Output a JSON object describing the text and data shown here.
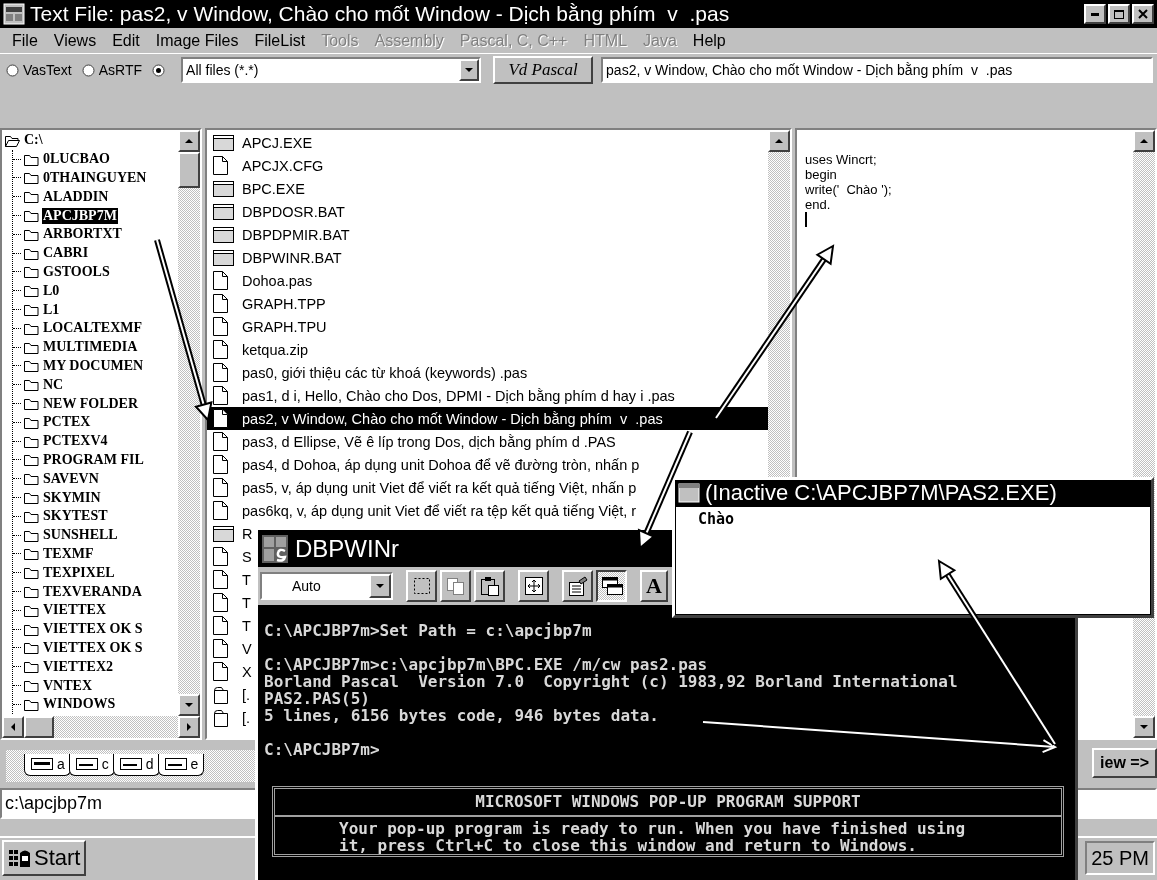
{
  "window": {
    "title": "Text File: pas2, v Window, Chào cho mốt Window - Dịch bằng phím  v  .pas"
  },
  "menu": [
    {
      "label": "File",
      "disabled": false
    },
    {
      "label": "Views",
      "disabled": false
    },
    {
      "label": "Edit",
      "disabled": false
    },
    {
      "label": "Image Files",
      "disabled": false
    },
    {
      "label": "FileList",
      "disabled": false
    },
    {
      "label": "Tools",
      "disabled": true
    },
    {
      "label": "Assembly",
      "disabled": true
    },
    {
      "label": "Pascal, C, C++",
      "disabled": true
    },
    {
      "label": "HTML",
      "disabled": true
    },
    {
      "label": "Java",
      "disabled": true
    },
    {
      "label": "Help",
      "disabled": false
    }
  ],
  "toolbar": {
    "radios": [
      {
        "label": "VasText",
        "selected": false
      },
      {
        "label": "AsRTF",
        "selected": false
      },
      {
        "selected": true
      }
    ],
    "filter": "All files (*.*)",
    "pascal_button": "Vd Pascal",
    "path": "pas2, v Window, Chào cho mốt Window - Dịch bằng phím  v  .pas"
  },
  "tree": {
    "label": "C:\\",
    "expanded": true,
    "children": [
      {
        "label": "0LUCBAO",
        "selected": false
      },
      {
        "label": "0THAINGUYEN",
        "selected": false
      },
      {
        "label": "ALADDIN",
        "selected": false
      },
      {
        "label": "APCJBP7M",
        "selected": true
      },
      {
        "label": "ARBORTXT",
        "selected": false
      },
      {
        "label": "CABRI",
        "selected": false
      },
      {
        "label": "GSTOOLS",
        "selected": false
      },
      {
        "label": "L0",
        "selected": false
      },
      {
        "label": "L1",
        "selected": false
      },
      {
        "label": "LOCALTEXMF",
        "selected": false
      },
      {
        "label": "MULTIMEDIA",
        "selected": false
      },
      {
        "label": "MY DOCUMEN",
        "selected": false
      },
      {
        "label": "NC",
        "selected": false
      },
      {
        "label": "NEW FOLDER",
        "selected": false
      },
      {
        "label": "PCTEX",
        "selected": false
      },
      {
        "label": "PCTEXV4",
        "selected": false
      },
      {
        "label": "PROGRAM FIL",
        "selected": false
      },
      {
        "label": "SAVEVN",
        "selected": false
      },
      {
        "label": "SKYMIN",
        "selected": false
      },
      {
        "label": "SKYTEST",
        "selected": false
      },
      {
        "label": "SUNSHELL",
        "selected": false
      },
      {
        "label": "TEXMF",
        "selected": false
      },
      {
        "label": "TEXPIXEL",
        "selected": false
      },
      {
        "label": "TEXVERANDA",
        "selected": false
      },
      {
        "label": "VIETTEX",
        "selected": false
      },
      {
        "label": "VIETTEX OK S",
        "selected": false
      },
      {
        "label": "VIETTEX OK S",
        "selected": false
      },
      {
        "label": "VIETTEX2",
        "selected": false
      },
      {
        "label": "VNTEX",
        "selected": false
      },
      {
        "label": "WINDOWS",
        "selected": false
      }
    ]
  },
  "file_list": {
    "rows": [
      {
        "name": "APCJ.EXE",
        "kind": "program",
        "selected": false
      },
      {
        "name": "APCJX.CFG",
        "kind": "document",
        "selected": false
      },
      {
        "name": "BPC.EXE",
        "kind": "program",
        "selected": false
      },
      {
        "name": "DBPDOSR.BAT",
        "kind": "program",
        "selected": false
      },
      {
        "name": "DBPDPMIR.BAT",
        "kind": "program",
        "selected": false
      },
      {
        "name": "DBPWINR.BAT",
        "kind": "program",
        "selected": false
      },
      {
        "name": "Dohoa.pas",
        "kind": "document",
        "selected": false
      },
      {
        "name": "GRAPH.TPP",
        "kind": "document",
        "selected": false
      },
      {
        "name": "GRAPH.TPU",
        "kind": "document",
        "selected": false
      },
      {
        "name": "ketqua.zip",
        "kind": "document",
        "selected": false
      },
      {
        "name": "pas0, giới thiệu các từ khoá (keywords) .pas",
        "kind": "document",
        "selected": false
      },
      {
        "name": "pas1, d i, Hello, Chào cho Dos, DPMI - Dịch bằng phím d hay i .pas",
        "kind": "document",
        "selected": false
      },
      {
        "name": "pas2, v Window, Chào cho mốt Window - Dịch bằng phím  v  .pas",
        "kind": "document",
        "selected": true
      },
      {
        "name": "pas3, d Ellipse, Vẽ ê líp trong Dos, dịch bằng phím d .PAS",
        "kind": "document",
        "selected": false
      },
      {
        "name": "pas4, d Dohoa, áp dụng unit Dohoa để vẽ đường tròn, nhấn p",
        "kind": "document",
        "selected": false
      },
      {
        "name": "pas5, v, áp dụng unit Viet để viết ra kết quả tiếng Việt, nhấn p",
        "kind": "document",
        "selected": false
      },
      {
        "name": "pas6kq, v, áp dụng unit Viet để viết ra tệp kết quả tiếng Việt, r",
        "kind": "document",
        "selected": false
      },
      {
        "name": "R",
        "kind": "program",
        "selected": false
      },
      {
        "name": "S",
        "kind": "document",
        "selected": false
      },
      {
        "name": "T",
        "kind": "document",
        "selected": false
      },
      {
        "name": "T",
        "kind": "document",
        "selected": false
      },
      {
        "name": "T",
        "kind": "document",
        "selected": false
      },
      {
        "name": "V",
        "kind": "document",
        "selected": false
      },
      {
        "name": "X",
        "kind": "document",
        "selected": false
      },
      {
        "name": "[.",
        "kind": "folder",
        "selected": false
      },
      {
        "name": "[.",
        "kind": "folder",
        "selected": false
      }
    ]
  },
  "editor": {
    "lines": [
      "uses Wincrt;",
      "begin",
      "write('  Chào ');",
      "end."
    ]
  },
  "drive_tabs": [
    {
      "label": "a",
      "kind": "floppy"
    },
    {
      "label": "c",
      "kind": "disk"
    },
    {
      "label": "d",
      "kind": "disk"
    },
    {
      "label": "e",
      "kind": "disk"
    }
  ],
  "view_button": "iew =>",
  "current_path": "c:\\apcjbp7m",
  "taskbar": {
    "start": "Start",
    "clock": "25 PM"
  },
  "dos_window": {
    "title": "DBPWINr",
    "font_size": "Auto",
    "font_button": "A",
    "console_blocks": [
      [
        "C:\\APCJBP7m>Set Path = c:\\apcjbp7m"
      ],
      [
        "C:\\APCJBP7m>c:\\apcjbp7m\\BPC.EXE /m/cw pas2.pas",
        "Borland Pascal  Version 7.0  Copyright (c) 1983,92 Borland International",
        "PAS2.PAS(5)",
        "5 lines, 6156 bytes code, 946 bytes data."
      ],
      [
        "C:\\APCJBP7m>"
      ]
    ],
    "popup": {
      "title": "MICROSOFT WINDOWS POP-UP PROGRAM SUPPORT",
      "lines": [
        "Your pop-up program is ready to run. When you have finished using",
        "it, press Ctrl+C to close this window and return to Windows."
      ]
    }
  },
  "inactive_window": {
    "title": "(Inactive C:\\APCJBP7M\\PAS2.EXE)",
    "output": "Chào"
  }
}
